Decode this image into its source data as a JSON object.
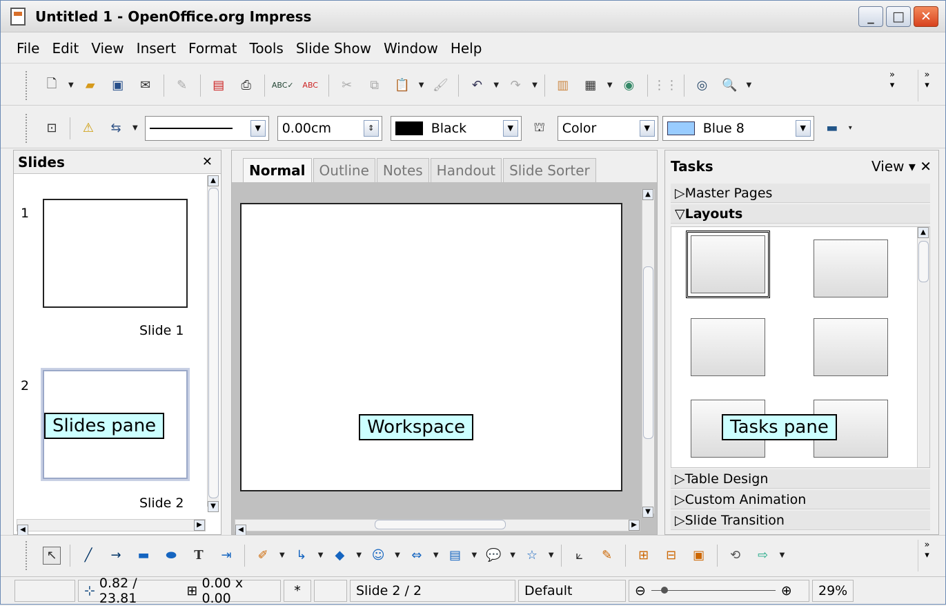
{
  "window": {
    "title": "Untitled 1 - OpenOffice.org Impress",
    "buttons": {
      "minimize": "_",
      "maximize": "□",
      "close": "✕"
    }
  },
  "menu": [
    "File",
    "Edit",
    "View",
    "Insert",
    "Format",
    "Tools",
    "Slide Show",
    "Window",
    "Help"
  ],
  "line_toolbar": {
    "width_value": "0.00cm",
    "line_color": "Black",
    "area_style": "Color",
    "area_color": "Blue 8"
  },
  "slides_pane": {
    "title": "Slides",
    "slides": [
      {
        "number": "1",
        "label": "Slide 1"
      },
      {
        "number": "2",
        "label": "Slide 2"
      }
    ]
  },
  "view_tabs": [
    "Normal",
    "Outline",
    "Notes",
    "Handout",
    "Slide Sorter"
  ],
  "tasks_pane": {
    "title": "Tasks",
    "view_label": "View",
    "sections": [
      "Master Pages",
      "Layouts",
      "Table Design",
      "Custom Animation",
      "Slide Transition"
    ]
  },
  "callouts": {
    "slides": "Slides pane",
    "workspace": "Workspace",
    "tasks": "Tasks pane"
  },
  "status": {
    "position": "0.82 / 23.81",
    "size": "0.00 x 0.00",
    "modified": "*",
    "slide": "Slide 2 / 2",
    "master": "Default",
    "zoom": "29%"
  },
  "colors": {
    "callout_bg": "#ccffff",
    "area_color": "#99ccff"
  }
}
